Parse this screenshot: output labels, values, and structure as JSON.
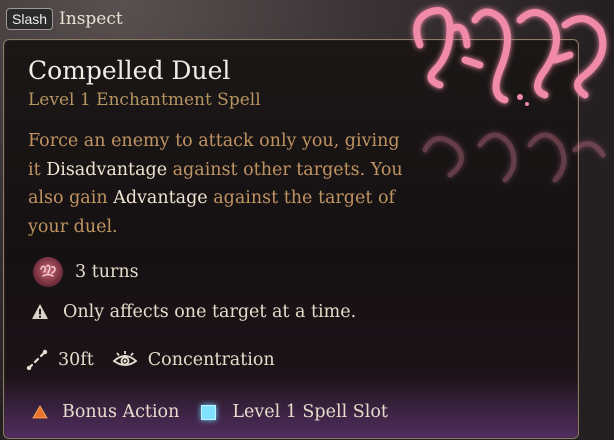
{
  "topbar": {
    "key_label": "Slash",
    "action_label": "Inspect"
  },
  "spell": {
    "title": "Compelled Duel",
    "subtitle": "Level 1 Enchantment Spell",
    "description": {
      "part1": "Force an enemy to attack only you, giving it ",
      "hl1": "Disadvantage",
      "part2": " against other targets.  You also gain ",
      "hl2": "Advantage",
      "part3": " against the target of your duel."
    },
    "duration": "3 turns",
    "warning": "Only affects one target at a time.",
    "range": "30ft",
    "concentration": "Concentration"
  },
  "footer": {
    "action_cost": "Bonus Action",
    "resource_cost": "Level 1 Spell Slot"
  },
  "icons": {
    "spell_art": "compelled-duel-glyph-icon",
    "duration": "duration-glyph-icon",
    "warning": "warning-icon",
    "range": "range-icon",
    "concentration": "concentration-eye-icon",
    "bonus_action": "bonus-action-triangle-icon",
    "spell_slot": "spell-slot-square-icon"
  },
  "colors": {
    "title": "#f2ede4",
    "subtitle": "#b59560",
    "description": "#c09462",
    "highlight": "#efe4d2",
    "spell_art": "#f08aa8",
    "bonus_action": "#e8742a",
    "spell_slot": "#7fe2ff"
  }
}
